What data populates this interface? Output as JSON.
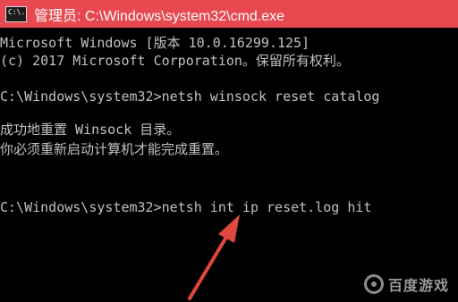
{
  "window": {
    "title": "管理员: C:\\Windows\\system32\\cmd.exe",
    "icon_name": "cmd-icon",
    "icon_text": "C:\\.",
    "titlebar_color": "#e8484f"
  },
  "console": {
    "lines": [
      "Microsoft Windows [版本 10.0.16299.125]",
      "(c) 2017 Microsoft Corporation。保留所有权利。",
      "C:\\Windows\\system32>netsh winsock reset catalog",
      "成功地重置 Winsock 目录。",
      "你必须重新启动计算机才能完成重置。",
      "C:\\Windows\\system32>netsh int ip reset.log hit"
    ],
    "text_color": "#c0c0c0",
    "background": "#000000"
  },
  "annotation": {
    "icon_name": "red-arrow-icon",
    "color": "#e0483e"
  },
  "watermark": {
    "icon_name": "baidu-games-logo-icon",
    "text": "百度游戏"
  }
}
